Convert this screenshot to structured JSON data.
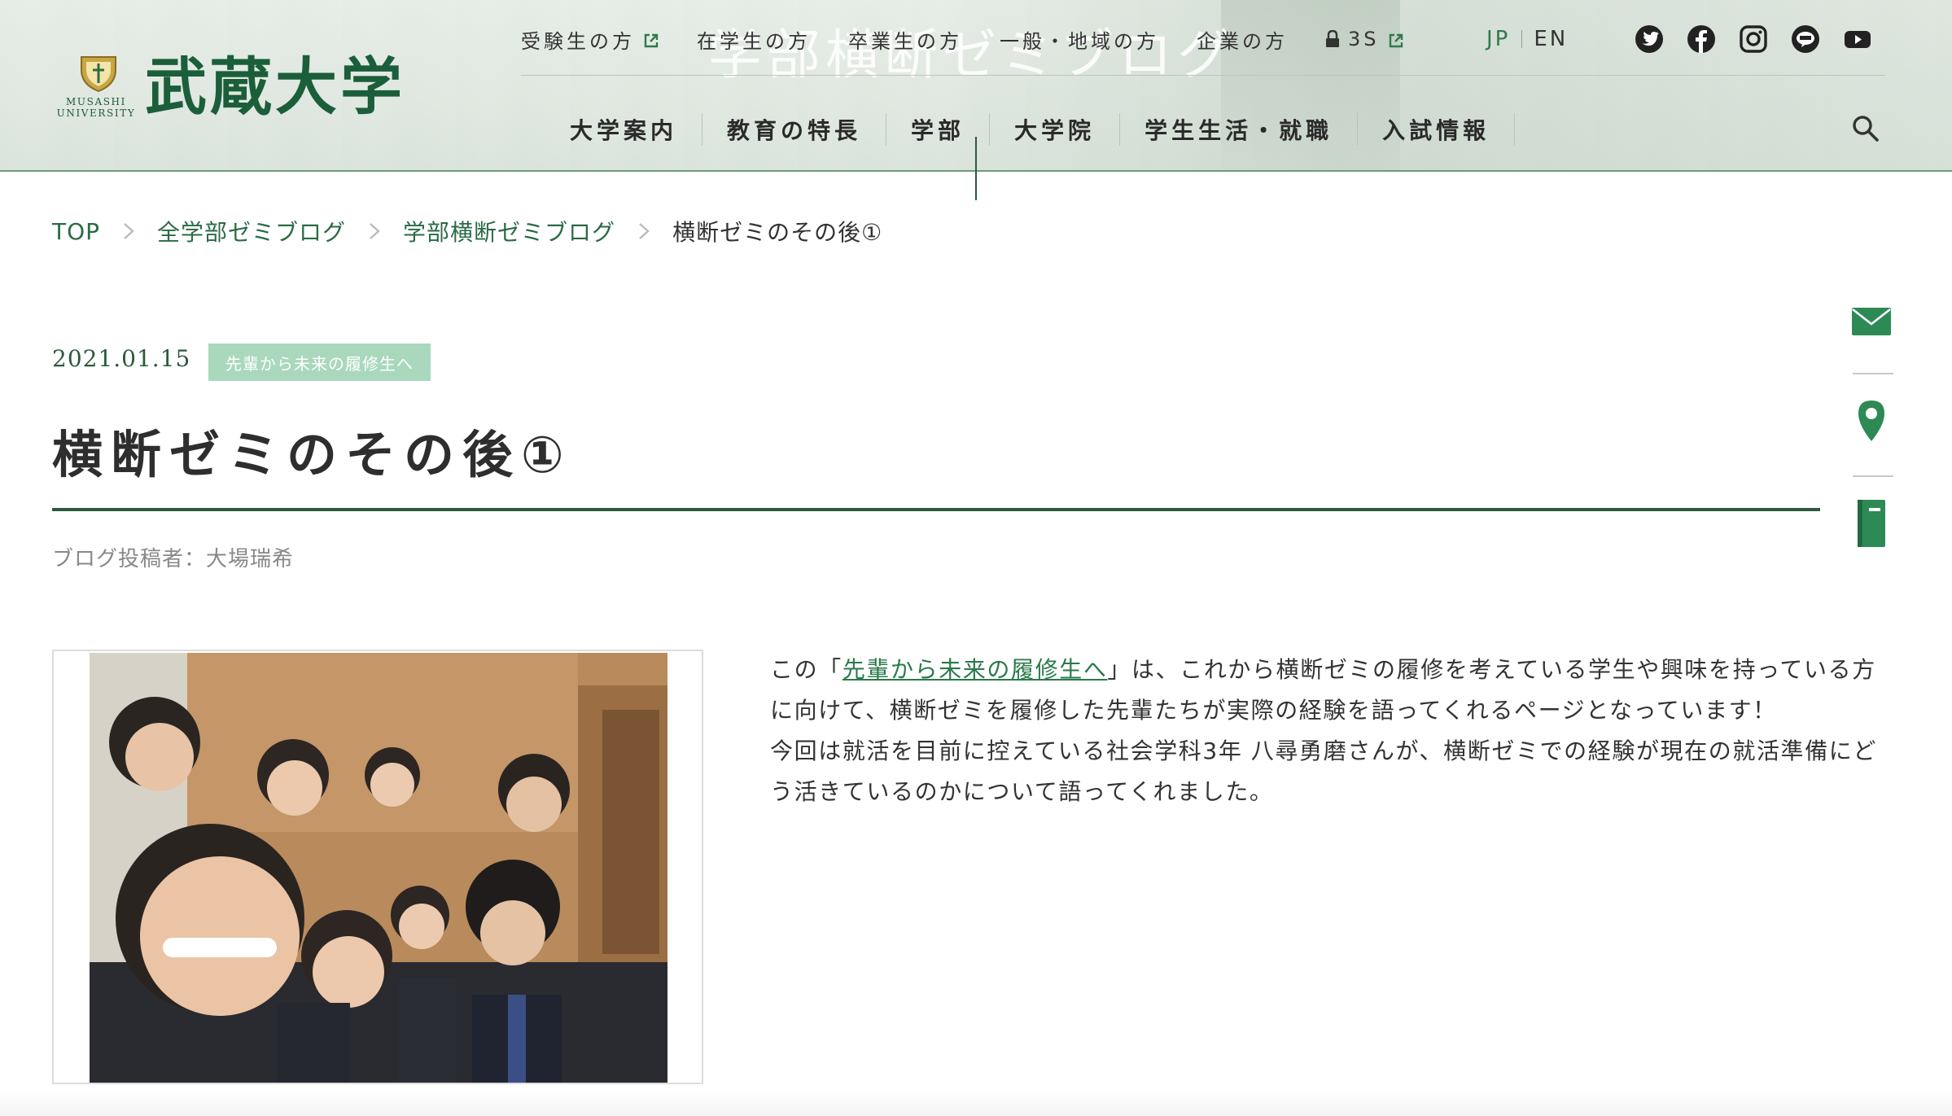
{
  "header": {
    "ghost_title": "学部横断ゼミブログ",
    "logo": {
      "jp": "武蔵大学",
      "en_line1": "MUSASHI",
      "en_line2": "UNIVERSITY"
    },
    "top_nav": [
      {
        "label": "受験生の方",
        "external": true
      },
      {
        "label": "在学生の方",
        "external": false
      },
      {
        "label": "卒業生の方",
        "external": false
      },
      {
        "label": "一般・地域の方",
        "external": false
      },
      {
        "label": "企業の方",
        "external": false
      },
      {
        "label": "3S",
        "external": true,
        "locked": true
      }
    ],
    "lang": {
      "jp": "JP",
      "en": "EN",
      "active": "JP"
    },
    "social": [
      "twitter-icon",
      "facebook-icon",
      "instagram-icon",
      "line-icon",
      "youtube-icon"
    ],
    "main_nav": [
      "大学案内",
      "教育の特長",
      "学部",
      "大学院",
      "学生生活・就職",
      "入試情報"
    ]
  },
  "breadcrumb": [
    "TOP",
    "全学部ゼミブログ",
    "学部横断ゼミブログ",
    "横断ゼミのその後①"
  ],
  "article": {
    "date": "2021.01.15",
    "tag": "先輩から未来の履修生へ",
    "title": "横断ゼミのその後①",
    "author": "ブログ投稿者：大場瑞希",
    "body_intro_prefix": "この「",
    "body_link": "先輩から未来の履修生へ",
    "body_intro_suffix": "」は、これから横断ゼミの履修を考えている学生や興味を持っている方に向けて、横断ゼミを履修した先輩たちが実際の経験を語ってくれるページとなっています！",
    "body_para2": "今回は就活を目前に控えている社会学科3年 八尋勇磨さんが、横断ゼミでの経験が現在の就活準備にどう活きているのかについて語ってくれました。"
  },
  "side_utils": [
    "mail-icon",
    "map-pin-icon",
    "book-icon"
  ],
  "colors": {
    "brand_green": "#1b5e3a",
    "link_green": "#2a6b45",
    "tag_bg": "#a9d8bd",
    "rule_green": "#2d5a3d"
  }
}
